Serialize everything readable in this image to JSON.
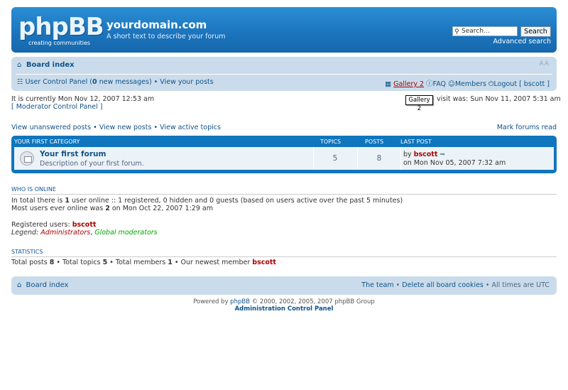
{
  "header": {
    "logo_text": "phpBB",
    "logo_subtext": "creating communities",
    "site_title": "yourdomain.com",
    "site_description": "A short text to describe your forum",
    "search_placeholder": "Search…",
    "search_button": "Search",
    "advanced_search": "Advanced search"
  },
  "navbar": {
    "board_index": "Board index",
    "font_size_control": "AA",
    "ucp": "User Control Panel",
    "new_messages_count": "0",
    "new_messages_label": "new messages",
    "view_posts": "View your posts",
    "gallery": "Gallery 2",
    "faq": "FAQ",
    "members": "Members",
    "logout": "Logout [ bscott ]"
  },
  "tooltip": "Gallery 2",
  "info": {
    "current_time": "It is currently Mon Nov 12, 2007 12:53 am",
    "last_visit": "visit was: Sun Nov 11, 2007 5:31 am",
    "moderator_panel": "[ Moderator Control Panel ]"
  },
  "links": {
    "unanswered": "View unanswered posts",
    "new_posts": "View new posts",
    "active_topics": "View active topics",
    "mark_read": "Mark forums read"
  },
  "forum_table": {
    "category": "Your first category",
    "col_topics": "Topics",
    "col_posts": "Posts",
    "col_last_post": "Last post",
    "rows": [
      {
        "title": "Your first forum",
        "description": "Description of your first forum.",
        "topics": "5",
        "posts": "8",
        "last_post_by_label": "by",
        "last_post_author": "bscott",
        "last_post_date": "on Mon Nov 05, 2007 7:32 am"
      }
    ]
  },
  "who_is_online": {
    "heading": "Who is online",
    "line1_a": "In total there is",
    "line1_count": "1",
    "line1_b": "user online :: 1 registered, 0 hidden and 0 guests (based on users active over the past 5 minutes)",
    "line2_a": "Most users ever online was",
    "line2_count": "2",
    "line2_b": "on Mon Oct 22, 2007 1:29 am",
    "registered_label": "Registered users:",
    "registered_user": "bscott",
    "legend_label": "Legend:",
    "legend_admin": "Administrators",
    "legend_gmod": "Global moderators"
  },
  "statistics": {
    "heading": "Statistics",
    "total_posts_label": "Total posts",
    "total_posts": "8",
    "total_topics_label": "Total topics",
    "total_topics": "5",
    "total_members_label": "Total members",
    "total_members": "1",
    "newest_label": "Our newest member",
    "newest_member": "bscott"
  },
  "footer_bar": {
    "board_index": "Board index",
    "team": "The team",
    "delete_cookies": "Delete all board cookies",
    "timezone": "All times are UTC"
  },
  "footer": {
    "powered_by": "Powered by",
    "phpbb_link": "phpBB",
    "copyright": "© 2000, 2002, 2005, 2007 phpBB Group",
    "acp": "Administration Control Panel"
  }
}
